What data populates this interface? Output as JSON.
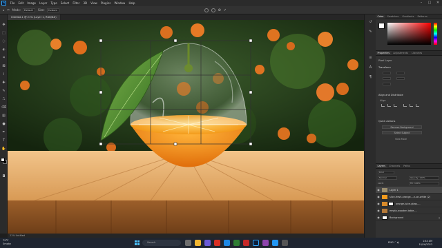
{
  "app": {
    "logo": "Ps",
    "menu": [
      "File",
      "Edit",
      "Image",
      "Layer",
      "Type",
      "Select",
      "Filter",
      "3D",
      "View",
      "Plugins",
      "Window",
      "Help"
    ]
  },
  "options": {
    "mode_label": "Mode:",
    "mode_value": "Default",
    "size_label": "Size:",
    "size_value": "Custom"
  },
  "document": {
    "tab_title": "Untitled-1 @ 21% (Layer 1, RGB/8#)",
    "status": "21%    Untitled"
  },
  "color_panel": {
    "tabs": [
      "Color",
      "Swatches",
      "Gradients",
      "Patterns"
    ],
    "hue_color": "#ff0000"
  },
  "properties_panel": {
    "tabs": [
      "Properties",
      "Adjustments",
      "Libraries"
    ],
    "layer_kind": "Pixel Layer",
    "transform_title": "Transform",
    "align_title": "Align and Distribute",
    "align_label": "Align:",
    "quick_actions_title": "Quick Actions",
    "quick_actions": [
      "Remove Background",
      "Select Subject"
    ],
    "more_label": "View More"
  },
  "layers_panel": {
    "tabs": [
      "Layers",
      "Channels",
      "Paths"
    ],
    "kind_filter": "Kind",
    "blend_mode": "Normal",
    "opacity_label": "Opacity: 100%",
    "fill_label": "Fill: 100%",
    "lock_label": "Lock:",
    "layers": [
      {
        "name": "Layer 1",
        "selected": true,
        "thumb": "#9b8e6e",
        "mask": false
      },
      {
        "name": "slice-fresh-orange-...n-on-white (2)",
        "selected": false,
        "thumb": "#f29a1d",
        "mask": false
      },
      {
        "name": "orange-juice-glass-...",
        "selected": false,
        "thumb": "#d98a2a",
        "mask": true
      },
      {
        "name": "empty-wooden-table-...",
        "selected": false,
        "thumb": "#b57a3a",
        "mask": false
      },
      {
        "name": "Background",
        "selected": false,
        "thumb": "#ffffff",
        "mask": false
      }
    ]
  },
  "taskbar": {
    "weather_temp": "79°F",
    "weather_desc": "Smoky",
    "search_placeholder": "Search",
    "lang": "ENG",
    "time": "1:44 AM",
    "date": "10/16/2023"
  }
}
